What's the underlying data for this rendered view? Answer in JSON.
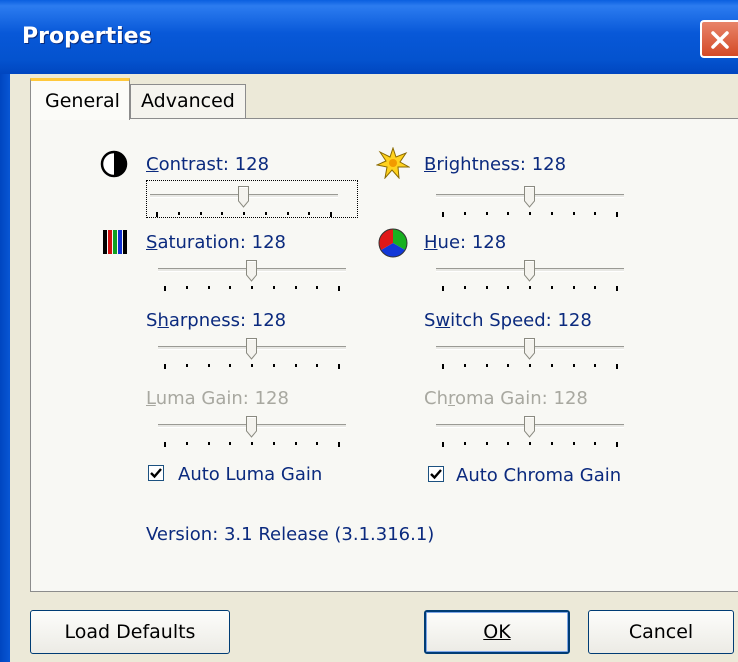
{
  "window": {
    "title": "Properties"
  },
  "tabs": [
    {
      "label": "General",
      "active": true
    },
    {
      "label": "Advanced",
      "active": false
    }
  ],
  "sliders": {
    "contrast": {
      "label": "Contrast:",
      "accel": "C",
      "value": "128",
      "enabled": true
    },
    "brightness": {
      "label": "Brightness:",
      "accel": "B",
      "value": "128",
      "enabled": true
    },
    "saturation": {
      "label": "Saturation:",
      "accel": "S",
      "value": "128",
      "enabled": true
    },
    "hue": {
      "label": "Hue:",
      "accel": "H",
      "value": "128",
      "enabled": true
    },
    "sharpness": {
      "label": "Sharpness:",
      "accel": "h",
      "value": "128",
      "enabled": true
    },
    "switch_speed": {
      "label": "Switch Speed:",
      "accel": "w",
      "value": "128",
      "enabled": true
    },
    "luma_gain": {
      "label": "Luma Gain:",
      "accel": "L",
      "value": "128",
      "enabled": false
    },
    "chroma_gain": {
      "label": "Chroma Gain:",
      "accel": "r",
      "value": "128",
      "enabled": false
    }
  },
  "checkboxes": {
    "auto_luma": {
      "label": "Auto Luma Gain",
      "checked": true
    },
    "auto_chroma": {
      "label": "Auto Chroma Gain",
      "checked": true
    }
  },
  "version": "Version: 3.1 Release (3.1.316.1)",
  "buttons": {
    "load_defaults": "Load Defaults",
    "ok": "OK",
    "cancel": "Cancel"
  },
  "icons": {
    "contrast": "contrast-icon",
    "brightness": "brightness-icon",
    "saturation": "saturation-icon",
    "hue": "hue-icon",
    "close": "close-icon"
  },
  "colors": {
    "titlebar": "#0453cf",
    "label": "#0b2a7e",
    "disabled": "#a8a8a0",
    "close": "#d44a26"
  }
}
